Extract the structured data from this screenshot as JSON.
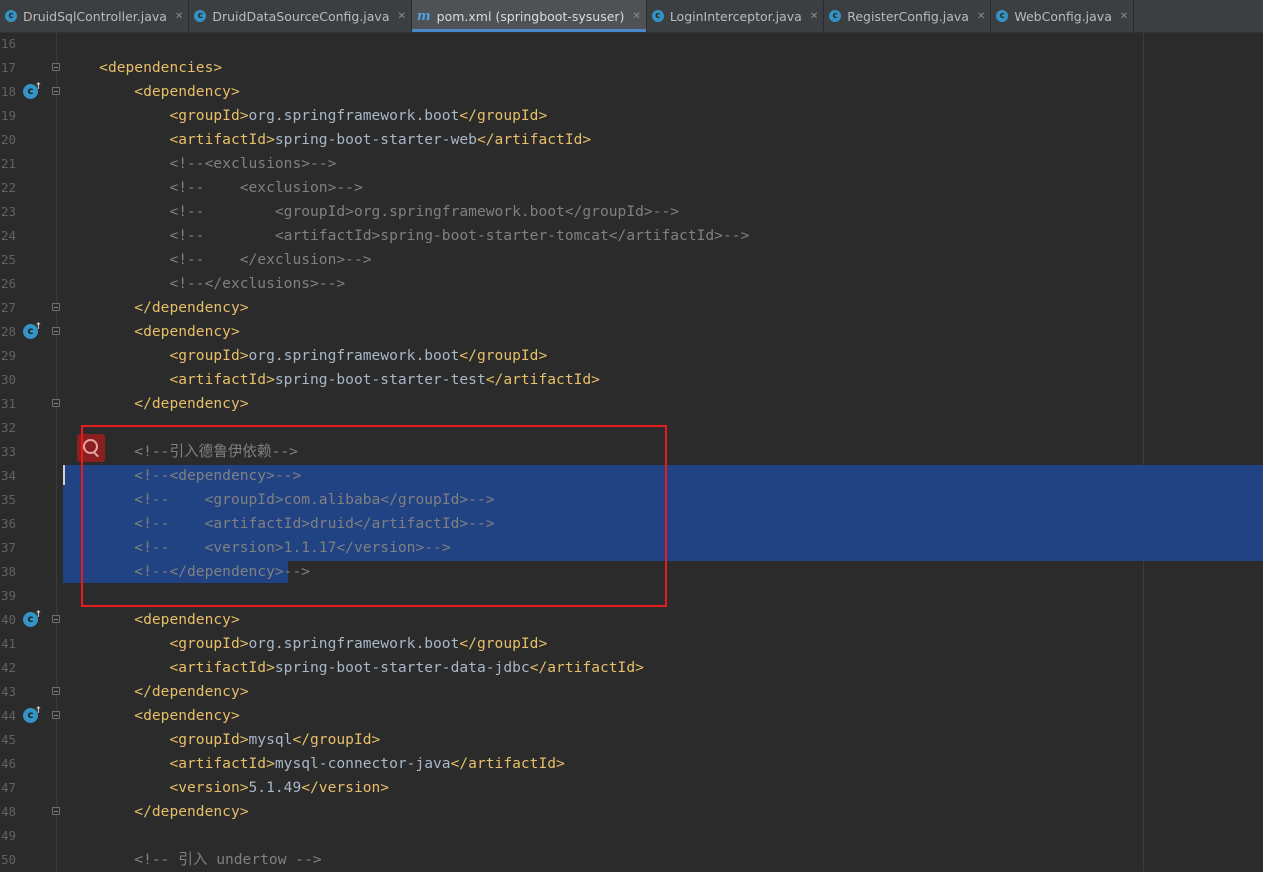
{
  "tabs": [
    {
      "label": "DruidSqlController.java",
      "icon": "java-class-icon",
      "active": false
    },
    {
      "label": "DruidDataSourceConfig.java",
      "icon": "java-class-icon",
      "active": false
    },
    {
      "label": "pom.xml (springboot-sysuser)",
      "icon": "maven-icon",
      "active": true
    },
    {
      "label": "LoginInterceptor.java",
      "icon": "java-class-icon",
      "active": false
    },
    {
      "label": "RegisterConfig.java",
      "icon": "java-class-icon",
      "active": false
    },
    {
      "label": "WebConfig.java",
      "icon": "java-class-icon",
      "active": false
    }
  ],
  "editor": {
    "colors": {
      "tag": "#e8bf6a",
      "text": "#a9b7c6",
      "comment": "#808080",
      "selection": "#214283",
      "highlight_box": "#e51c1c"
    },
    "lines": [
      {
        "num": "16",
        "parts": []
      },
      {
        "num": "17",
        "parts": [
          {
            "t": "    "
          },
          {
            "t": "<dependencies>",
            "c": "tag"
          }
        ],
        "fold": true
      },
      {
        "num": "18",
        "parts": [
          {
            "t": "        "
          },
          {
            "t": "<dependency>",
            "c": "tag"
          }
        ],
        "fold": true,
        "gutter_icon": true
      },
      {
        "num": "19",
        "parts": [
          {
            "t": "            "
          },
          {
            "t": "<groupId>",
            "c": "tag"
          },
          {
            "t": "org.springframework.boot"
          },
          {
            "t": "</groupId>",
            "c": "tag"
          }
        ]
      },
      {
        "num": "20",
        "parts": [
          {
            "t": "            "
          },
          {
            "t": "<artifactId>",
            "c": "tag"
          },
          {
            "t": "spring-boot-starter-web"
          },
          {
            "t": "</artifactId>",
            "c": "tag"
          }
        ]
      },
      {
        "num": "21",
        "parts": [
          {
            "t": "            "
          },
          {
            "t": "<!--<exclusions>-->",
            "c": "cm"
          }
        ]
      },
      {
        "num": "22",
        "parts": [
          {
            "t": "            "
          },
          {
            "t": "<!--    <exclusion>-->",
            "c": "cm"
          }
        ]
      },
      {
        "num": "23",
        "parts": [
          {
            "t": "            "
          },
          {
            "t": "<!--        <groupId>org.springframework.boot</groupId>-->",
            "c": "cm"
          }
        ]
      },
      {
        "num": "24",
        "parts": [
          {
            "t": "            "
          },
          {
            "t": "<!--        <artifactId>spring-boot-starter-tomcat</artifactId>-->",
            "c": "cm"
          }
        ]
      },
      {
        "num": "25",
        "parts": [
          {
            "t": "            "
          },
          {
            "t": "<!--    </exclusion>-->",
            "c": "cm"
          }
        ]
      },
      {
        "num": "26",
        "parts": [
          {
            "t": "            "
          },
          {
            "t": "<!--</exclusions>-->",
            "c": "cm"
          }
        ]
      },
      {
        "num": "27",
        "parts": [
          {
            "t": "        "
          },
          {
            "t": "</dependency>",
            "c": "tag"
          }
        ],
        "fold": true
      },
      {
        "num": "28",
        "parts": [
          {
            "t": "        "
          },
          {
            "t": "<dependency>",
            "c": "tag"
          }
        ],
        "fold": true,
        "gutter_icon": true
      },
      {
        "num": "29",
        "parts": [
          {
            "t": "            "
          },
          {
            "t": "<groupId>",
            "c": "tag"
          },
          {
            "t": "org.springframework.boot"
          },
          {
            "t": "</groupId>",
            "c": "tag"
          }
        ]
      },
      {
        "num": "30",
        "parts": [
          {
            "t": "            "
          },
          {
            "t": "<artifactId>",
            "c": "tag"
          },
          {
            "t": "spring-boot-starter-test"
          },
          {
            "t": "</artifactId>",
            "c": "tag"
          }
        ]
      },
      {
        "num": "31",
        "parts": [
          {
            "t": "        "
          },
          {
            "t": "</dependency>",
            "c": "tag"
          }
        ],
        "fold": true
      },
      {
        "num": "32",
        "parts": []
      },
      {
        "num": "33",
        "parts": [
          {
            "t": "        "
          },
          {
            "t": "<!--引入德鲁伊依赖-->",
            "c": "cm"
          }
        ]
      },
      {
        "num": "34",
        "parts": [
          {
            "t": "        "
          },
          {
            "t": "<!--<dependency>-->",
            "c": "cm"
          }
        ]
      },
      {
        "num": "35",
        "parts": [
          {
            "t": "        "
          },
          {
            "t": "<!--    <groupId>com.alibaba</groupId>-->",
            "c": "cm"
          }
        ]
      },
      {
        "num": "36",
        "parts": [
          {
            "t": "        "
          },
          {
            "t": "<!--    <artifactId>druid</artifactId>-->",
            "c": "cm"
          }
        ]
      },
      {
        "num": "37",
        "parts": [
          {
            "t": "        "
          },
          {
            "t": "<!--    <version>1.1.17</version>-->",
            "c": "cm"
          }
        ]
      },
      {
        "num": "38",
        "parts": [
          {
            "t": "        "
          },
          {
            "t": "<!--</dependency>-->",
            "c": "cm"
          }
        ]
      },
      {
        "num": "39",
        "parts": []
      },
      {
        "num": "40",
        "parts": [
          {
            "t": "        "
          },
          {
            "t": "<dependency>",
            "c": "tag"
          }
        ],
        "fold": true,
        "gutter_icon": true
      },
      {
        "num": "41",
        "parts": [
          {
            "t": "            "
          },
          {
            "t": "<groupId>",
            "c": "tag"
          },
          {
            "t": "org.springframework.boot"
          },
          {
            "t": "</groupId>",
            "c": "tag"
          }
        ]
      },
      {
        "num": "42",
        "parts": [
          {
            "t": "            "
          },
          {
            "t": "<artifactId>",
            "c": "tag"
          },
          {
            "t": "spring-boot-starter-data-jdbc"
          },
          {
            "t": "</artifactId>",
            "c": "tag"
          }
        ]
      },
      {
        "num": "43",
        "parts": [
          {
            "t": "        "
          },
          {
            "t": "</dependency>",
            "c": "tag"
          }
        ],
        "fold": true
      },
      {
        "num": "44",
        "parts": [
          {
            "t": "        "
          },
          {
            "t": "<dependency>",
            "c": "tag"
          }
        ],
        "fold": true,
        "gutter_icon": true
      },
      {
        "num": "45",
        "parts": [
          {
            "t": "            "
          },
          {
            "t": "<groupId>",
            "c": "tag"
          },
          {
            "t": "mysql"
          },
          {
            "t": "</groupId>",
            "c": "tag"
          }
        ]
      },
      {
        "num": "46",
        "parts": [
          {
            "t": "            "
          },
          {
            "t": "<artifactId>",
            "c": "tag"
          },
          {
            "t": "mysql-connector-java"
          },
          {
            "t": "</artifactId>",
            "c": "tag"
          }
        ]
      },
      {
        "num": "47",
        "parts": [
          {
            "t": "            "
          },
          {
            "t": "<version>",
            "c": "tag"
          },
          {
            "t": "5.1.49"
          },
          {
            "t": "</version>",
            "c": "tag"
          }
        ]
      },
      {
        "num": "48",
        "parts": [
          {
            "t": "        "
          },
          {
            "t": "</dependency>",
            "c": "tag"
          }
        ],
        "fold": true
      },
      {
        "num": "49",
        "parts": []
      },
      {
        "num": "50",
        "parts": [
          {
            "t": "        "
          },
          {
            "t": "<!-- 引入 undertow -->",
            "c": "cm"
          }
        ]
      }
    ]
  }
}
